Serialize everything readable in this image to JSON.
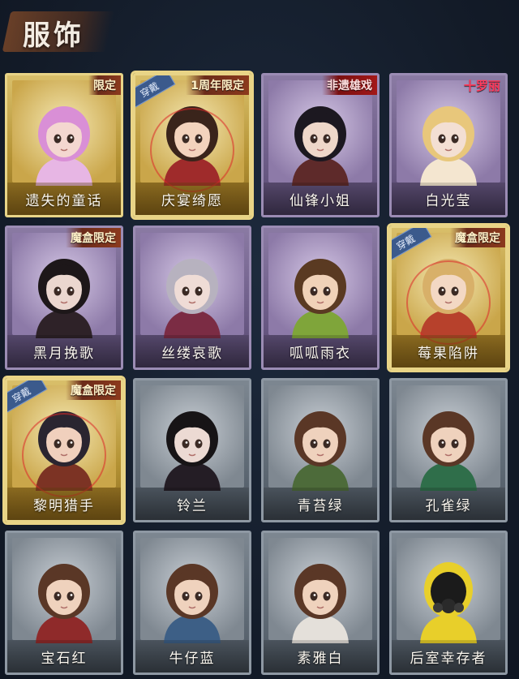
{
  "header": {
    "title": "服饰"
  },
  "cards": [
    {
      "name": "遗失的童话",
      "tier": "gold",
      "tag": "限定",
      "tag_style": "normal",
      "equipped": false,
      "hair": "#d98fd6",
      "cloth": "#e7b6e4",
      "skin": "#f4d7d0"
    },
    {
      "name": "庆宴绮愿",
      "tier": "gold",
      "tag": "1周年限定",
      "tag_style": "normal",
      "equipped": true,
      "badge": "穿戴",
      "hair": "#3a241b",
      "cloth": "#9f2b2b",
      "skin": "#f3d3bd"
    },
    {
      "name": "仙锋小姐",
      "tier": "purple",
      "tag": "非遗雄戏",
      "tag_style": "red",
      "equipped": false,
      "hair": "#1c1820",
      "cloth": "#5e2a2a",
      "skin": "#eed7c9"
    },
    {
      "name": "白光莹",
      "tier": "purple",
      "tag": "十罗丽",
      "tag_style": "pink",
      "equipped": false,
      "hair": "#e8c77b",
      "cloth": "#f4e6d0",
      "skin": "#f3dfd3"
    },
    {
      "name": "黑月挽歌",
      "tier": "purple",
      "tag": "魔盒限定",
      "tag_style": "normal",
      "equipped": false,
      "hair": "#1d1719",
      "cloth": "#2e2228",
      "skin": "#ebd7cf"
    },
    {
      "name": "丝缕哀歌",
      "tier": "purple",
      "tag": "",
      "tag_style": "normal",
      "equipped": false,
      "hair": "#b7b2bf",
      "cloth": "#7b2c44",
      "skin": "#efdcd6"
    },
    {
      "name": "呱呱雨衣",
      "tier": "purple",
      "tag": "",
      "tag_style": "normal",
      "equipped": false,
      "hair": "#5a3a22",
      "cloth": "#7fa53a",
      "skin": "#f0d2b8"
    },
    {
      "name": "莓果陷阱",
      "tier": "gold",
      "tag": "魔盒限定",
      "tag_style": "normal",
      "equipped": true,
      "badge": "穿戴",
      "hair": "#d8b069",
      "cloth": "#b7412c",
      "skin": "#f3d8c4"
    },
    {
      "name": "黎明猎手",
      "tier": "gold",
      "tag": "魔盒限定",
      "tag_style": "normal",
      "equipped": true,
      "badge": "穿戴",
      "hair": "#2a2530",
      "cloth": "#7c3324",
      "skin": "#f0d0bd"
    },
    {
      "name": "铃兰",
      "tier": "gray",
      "tag": "",
      "tag_style": "normal",
      "equipped": false,
      "hair": "#171416",
      "cloth": "#241d25",
      "skin": "#ecdad3"
    },
    {
      "name": "青苔绿",
      "tier": "gray",
      "tag": "",
      "tag_style": "normal",
      "equipped": false,
      "hair": "#5a3726",
      "cloth": "#4d6b3a",
      "skin": "#efd2bd"
    },
    {
      "name": "孔雀绿",
      "tier": "gray",
      "tag": "",
      "tag_style": "normal",
      "equipped": false,
      "hair": "#5a3726",
      "cloth": "#2f6e4a",
      "skin": "#efd2bd"
    },
    {
      "name": "宝石红",
      "tier": "gray",
      "tag": "",
      "tag_style": "normal",
      "equipped": false,
      "hair": "#5a3726",
      "cloth": "#8f2a2a",
      "skin": "#efd2bd"
    },
    {
      "name": "牛仔蓝",
      "tier": "gray",
      "tag": "",
      "tag_style": "normal",
      "equipped": false,
      "hair": "#5a3726",
      "cloth": "#3d5f86",
      "skin": "#efd2bd"
    },
    {
      "name": "素雅白",
      "tier": "gray",
      "tag": "",
      "tag_style": "normal",
      "equipped": false,
      "hair": "#5a3726",
      "cloth": "#e4e0da",
      "skin": "#efd2bd"
    },
    {
      "name": "后室幸存者",
      "tier": "gray",
      "tag": "",
      "tag_style": "normal",
      "equipped": false,
      "hair": "#e8cf2a",
      "cloth": "#e8cf2a",
      "skin": "#1b1b1b",
      "gasmask": true
    }
  ]
}
